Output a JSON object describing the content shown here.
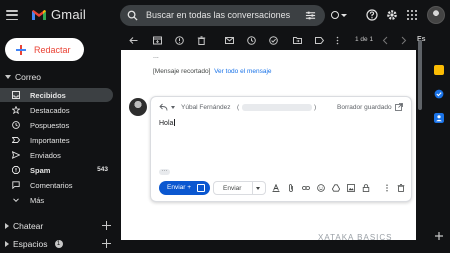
{
  "app": {
    "name": "Gmail"
  },
  "search": {
    "placeholder": "Buscar en todas las conversaciones"
  },
  "compose": {
    "label": "Redactar"
  },
  "sections": {
    "mail": "Correo",
    "chat": "Chatear",
    "spaces": "Espacios",
    "spaces_count": "1"
  },
  "nav": [
    {
      "label": "Recibidos",
      "icon": "inbox-icon",
      "count": "",
      "active": true
    },
    {
      "label": "Destacados",
      "icon": "star-icon",
      "count": ""
    },
    {
      "label": "Pospuestos",
      "icon": "clock-icon",
      "count": ""
    },
    {
      "label": "Importantes",
      "icon": "label-important-icon",
      "count": ""
    },
    {
      "label": "Enviados",
      "icon": "send-icon",
      "count": ""
    },
    {
      "label": "Spam",
      "icon": "spam-icon",
      "count": "543"
    },
    {
      "label": "Comentarios",
      "icon": "comment-icon",
      "count": ""
    },
    {
      "label": "Más",
      "icon": "chevron-down-icon",
      "count": ""
    }
  ],
  "pager": {
    "text": "1 de 1"
  },
  "message": {
    "ellipsis": "...",
    "trimmed_text": "[Mensaje recortado]",
    "view_all_link": "Ver todo el mensaje"
  },
  "reply": {
    "to_name": "Yúbal Fernández",
    "draft_status": "Borrador guardado",
    "body": "Hola",
    "send_schedule_label": "Enviar +",
    "send_label": "Enviar"
  },
  "watermark": "XATAKA BASICS",
  "colors": {
    "background": "#111214",
    "surface": "#3c4043",
    "primary_button": "#0b57d0",
    "compose_accent": "#ea4335",
    "link": "#1a73e8"
  }
}
